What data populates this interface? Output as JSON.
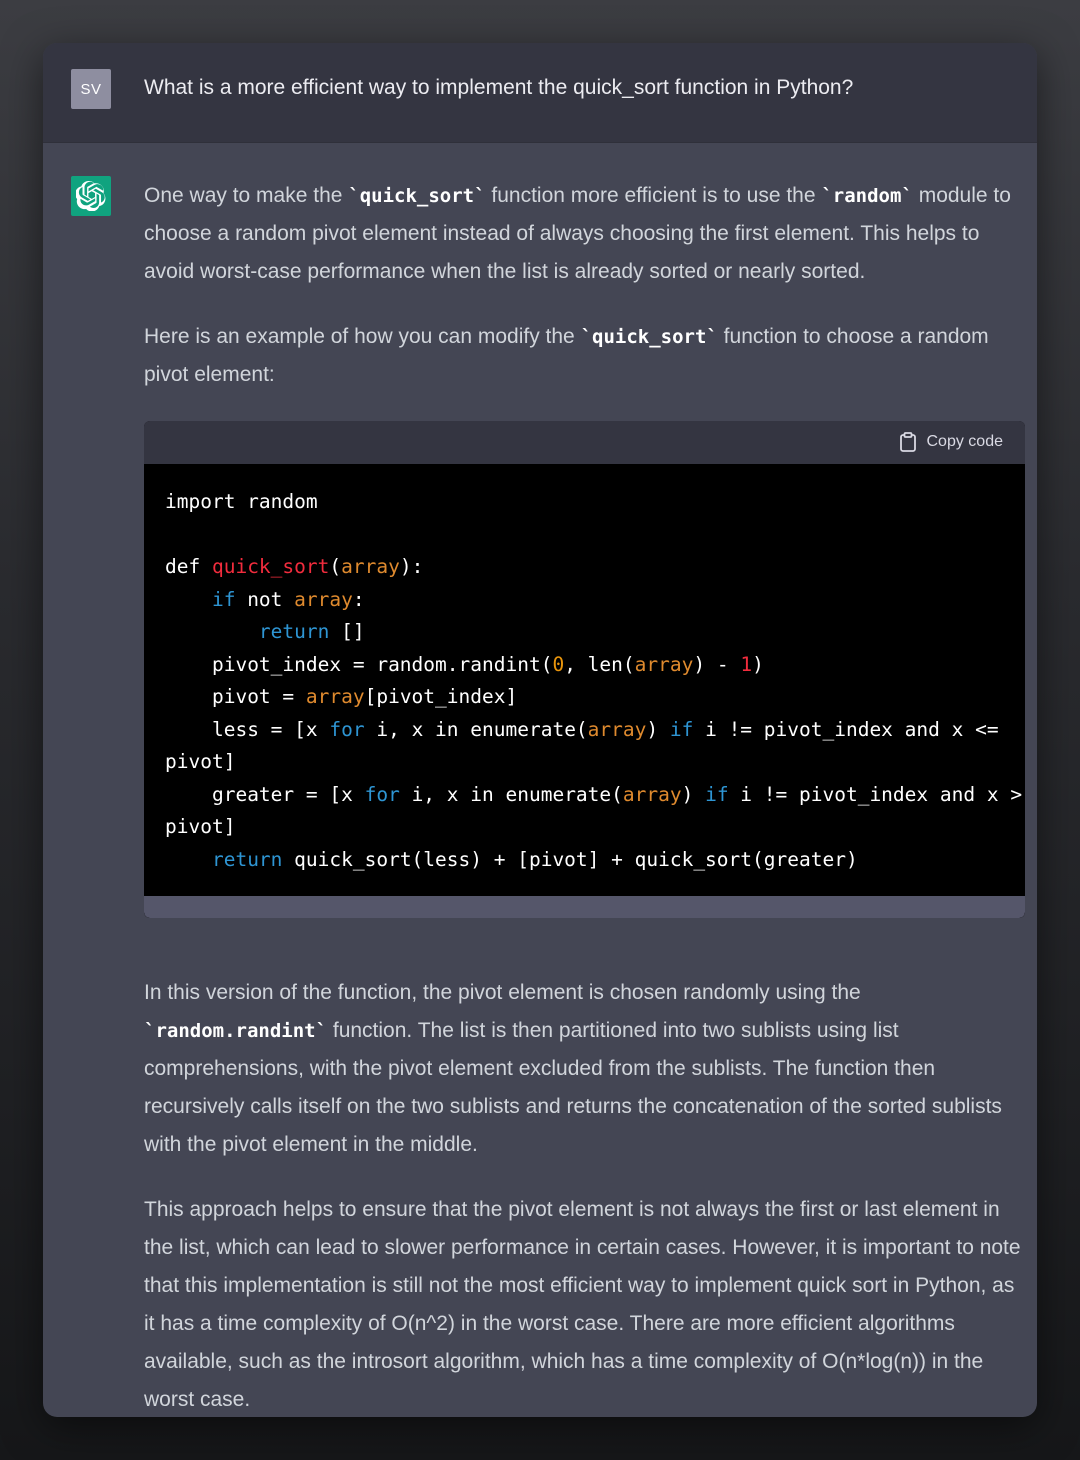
{
  "user": {
    "avatar_initials": "SV",
    "message": "What is a more efficient way to implement the quick_sort function in Python?"
  },
  "assistant": {
    "avatar_icon": "openai-logo-icon",
    "p1": {
      "a": "One way to make the ",
      "code1": "`quick_sort`",
      "b": " function more efficient is to use the ",
      "code2": "`random`",
      "c": " module to choose a random pivot element instead of always choosing the first element. This helps to avoid worst-case performance when the list is already sorted or nearly sorted."
    },
    "p2": {
      "a": "Here is an example of how you can modify the ",
      "code1": "`quick_sort`",
      "b": " function to choose a random pivot element:"
    },
    "codeblock": {
      "copy_label": "Copy code",
      "lines": {
        "l1": "import random",
        "def": "def ",
        "fname": "quick_sort",
        "array": "array",
        "if_kw": "if",
        "not": " not ",
        "return_kw": "return",
        "empty_list": "[]",
        "pivot_index_a": "pivot_index = random.randint(",
        "zero": "0",
        "pivot_index_b": ", len(",
        "pivot_index_c": ") - ",
        "one": "1",
        "pivot_a": "pivot = ",
        "pivot_b": "[pivot_index]",
        "less_a": "less = [x ",
        "for_kw": "for",
        "less_b": " i, x in enumerate(",
        "less_c": ") ",
        "less_d": " i != pivot_index and x <=",
        "pivot_wrap": "pivot]",
        "greater_a": "greater = [x ",
        "greater_d": " i != pivot_index and x >",
        "final": " quick_sort(less) + [pivot] + quick_sort(greater)"
      }
    },
    "p3": {
      "a": "In this version of the function, the pivot element is chosen randomly using the ",
      "code1": "`random.randint`",
      "b": " function. The list is then partitioned into two sublists using list comprehensions, with the pivot element excluded from the sublists. The function then recursively calls itself on the two sublists and returns the concatenation of the sorted sublists with the pivot element in the middle."
    },
    "p4": "This approach helps to ensure that the pivot element is not always the first or last element in the list, which can lead to slower performance in certain cases. However, it is important to note that this implementation is still not the most efficient way to implement quick sort in Python, as it has a time complexity of O(n^2) in the worst case. There are more efficient algorithms available, such as the introsort algorithm, which has a time complexity of O(n*log(n)) in the worst case."
  },
  "colors": {
    "assistant_avatar_bg": "#10a37f",
    "user_avatar_bg": "#8e8ea0",
    "keyword": "#2e95d3",
    "function_name": "#f22c3d",
    "variable": "#df8a2e"
  }
}
